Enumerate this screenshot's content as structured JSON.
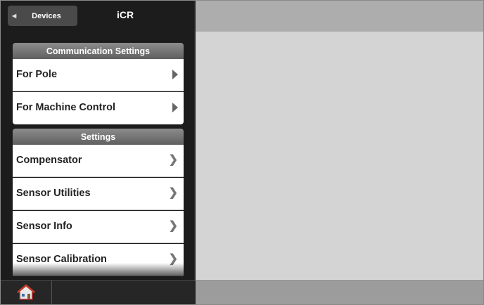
{
  "header": {
    "back_label": "Devices",
    "title": "iCR",
    "back_icon": "triangle-left-icon"
  },
  "groups": [
    {
      "title": "Communication Settings",
      "items": [
        {
          "label": "For Pole",
          "icon": "triangle-right-icon"
        },
        {
          "label": "For Machine Control",
          "icon": "triangle-right-icon"
        }
      ]
    },
    {
      "title": "Settings",
      "items": [
        {
          "label": "Compensator",
          "icon": "chevron-right-icon"
        },
        {
          "label": "Sensor Utilities",
          "icon": "chevron-right-icon"
        },
        {
          "label": "Sensor Info",
          "icon": "chevron-right-icon"
        },
        {
          "label": "Sensor Calibration",
          "icon": "chevron-right-icon"
        }
      ]
    }
  ],
  "footer": {
    "home_icon": "home-icon"
  },
  "colors": {
    "sidebar_bg": "#1c1c1c",
    "header_gray": "#adadad",
    "main_bg": "#d4d4d4",
    "row_bg": "#ffffff"
  }
}
